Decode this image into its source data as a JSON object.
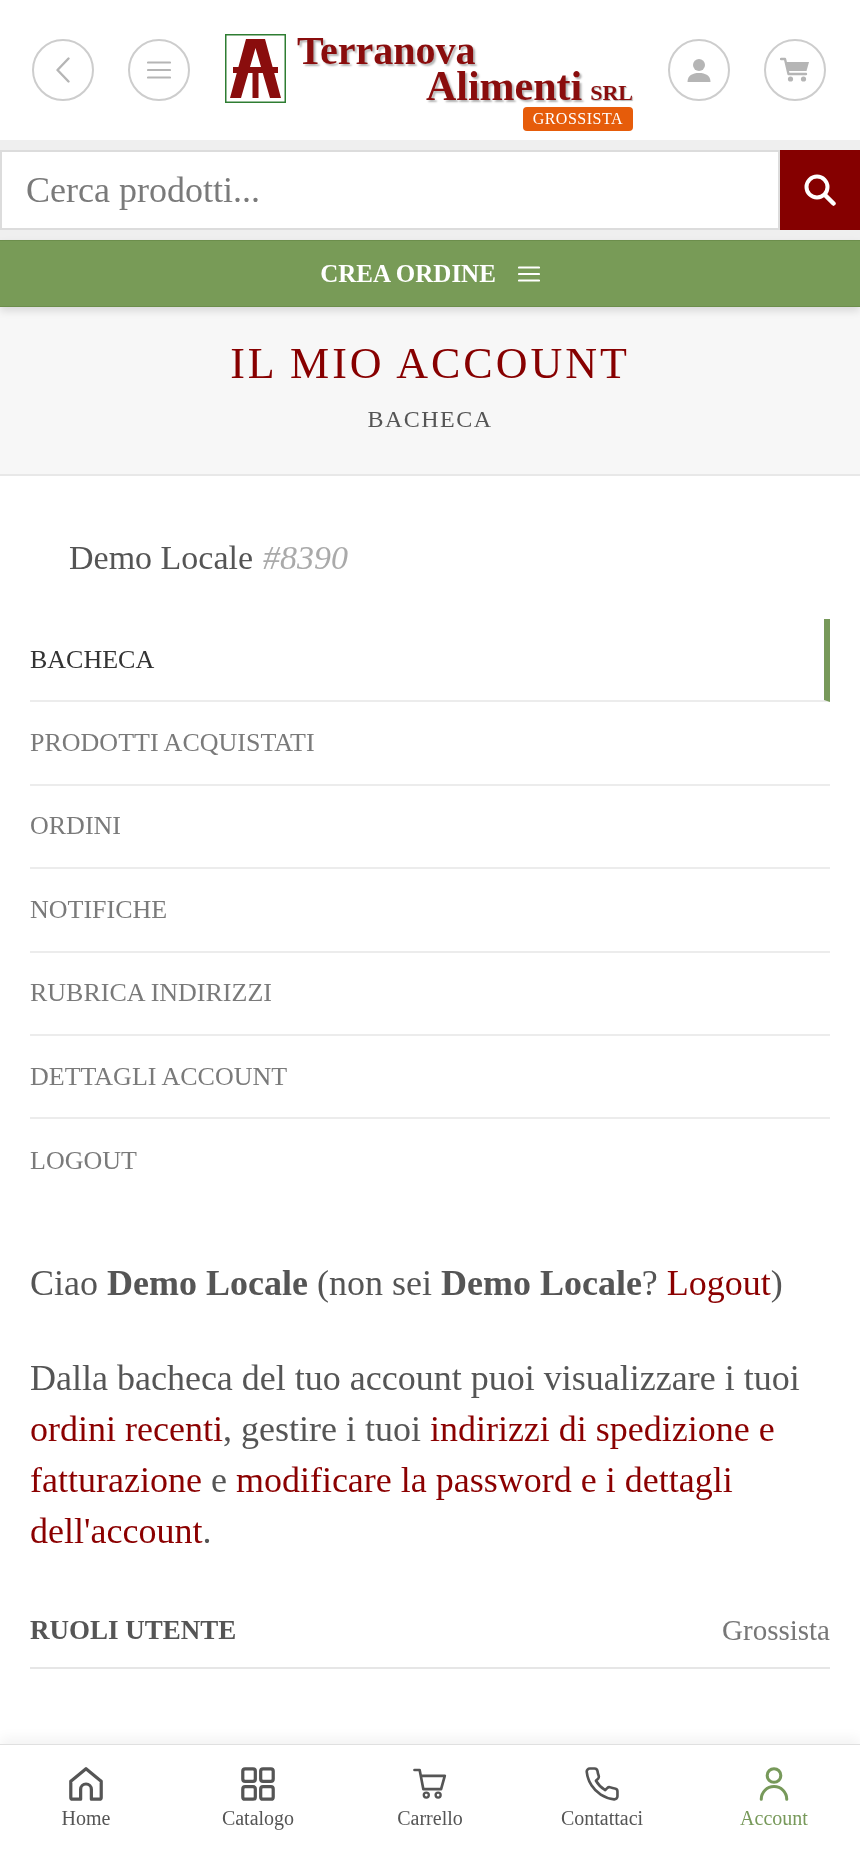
{
  "header": {
    "logo": {
      "line_1": "Terranova",
      "line_2": "Alimenti",
      "suffix": "SRL",
      "badge": "GROSSISTA"
    }
  },
  "search": {
    "placeholder": "Cerca prodotti..."
  },
  "order_bar": {
    "label": "CREA ORDINE"
  },
  "page_header": {
    "title": "IL MIO ACCOUNT",
    "subtitle": "BACHECA"
  },
  "account": {
    "name": "Demo Locale",
    "number": "#8390"
  },
  "account_menu": [
    {
      "label": "BACHECA",
      "selected": true
    },
    {
      "label": "PRODOTTI ACQUISTATI",
      "selected": false
    },
    {
      "label": "ORDINI",
      "selected": false
    },
    {
      "label": "NOTIFICHE",
      "selected": false
    },
    {
      "label": "RUBRICA INDIRIZZI",
      "selected": false
    },
    {
      "label": "DETTAGLI ACCOUNT",
      "selected": false
    },
    {
      "label": "LOGOUT",
      "selected": false
    }
  ],
  "greeting": [
    {
      "kind": "text",
      "text": "Ciao **Demo Locale** (non sei **Demo Locale**? "
    },
    {
      "kind": "link",
      "parts": [
        "Logout"
      ]
    },
    {
      "kind": "text",
      "text": ")"
    }
  ],
  "description": [
    {
      "kind": "text",
      "text": "Dalla bacheca del tuo account puoi visualizzare i tuoi "
    },
    {
      "kind": "link",
      "parts": [
        "ordini recenti"
      ]
    },
    {
      "kind": "text",
      "text": ", gestire i tuoi "
    },
    {
      "kind": "link",
      "parts": [
        "indirizzi di spedizione e",
        "fatturazione"
      ]
    },
    {
      "kind": "text",
      "text": " e "
    },
    {
      "kind": "link",
      "parts": [
        "modificare la password e i dettagli",
        "dell'account"
      ]
    },
    {
      "kind": "text",
      "text": "."
    }
  ],
  "user_roles": {
    "label": "RUOLI UTENTE",
    "value": "Grossista"
  },
  "bottom_nav": [
    {
      "label": "Home",
      "selected": false
    },
    {
      "label": "Catalogo",
      "selected": false
    },
    {
      "label": "Carrello",
      "selected": false
    },
    {
      "label": "Contattaci",
      "selected": false
    },
    {
      "label": "Account",
      "selected": true
    }
  ]
}
